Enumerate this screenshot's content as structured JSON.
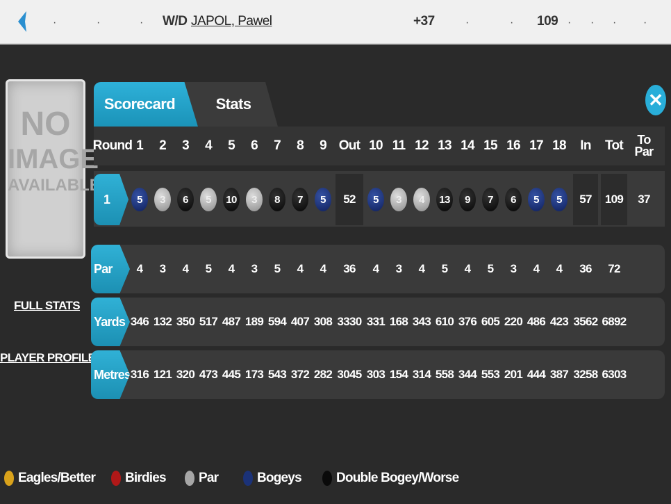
{
  "topbar": {
    "status": "W/D",
    "player_name": "JAPOL, Pawel",
    "to_par": "+37",
    "total": "109",
    "dots": [
      "·",
      "·",
      "·",
      "·",
      "·",
      "·",
      "·",
      "·",
      "·",
      "·"
    ]
  },
  "player_image": {
    "line1": "NO",
    "line2": "IMAGE",
    "line3": "AVAILABLE"
  },
  "links": {
    "full_stats": "FULL STATS",
    "player_profile": "PLAYER PROFILE"
  },
  "tabs": [
    {
      "label": "Scorecard",
      "active": true
    },
    {
      "label": "Stats",
      "active": false
    }
  ],
  "close_icon": "✕",
  "headers": {
    "round": "Round",
    "holes": [
      "1",
      "2",
      "3",
      "4",
      "5",
      "6",
      "7",
      "8",
      "9",
      "Out",
      "10",
      "11",
      "12",
      "13",
      "14",
      "15",
      "16",
      "17",
      "18",
      "In",
      "Tot",
      "To Par"
    ]
  },
  "round1": {
    "round": "1",
    "front": [
      {
        "score": "5",
        "type": "bogey"
      },
      {
        "score": "3",
        "type": "par"
      },
      {
        "score": "6",
        "type": "double"
      },
      {
        "score": "5",
        "type": "par"
      },
      {
        "score": "10",
        "type": "double"
      },
      {
        "score": "3",
        "type": "par"
      },
      {
        "score": "8",
        "type": "double"
      },
      {
        "score": "7",
        "type": "double"
      },
      {
        "score": "5",
        "type": "bogey"
      }
    ],
    "out": "52",
    "back": [
      {
        "score": "5",
        "type": "bogey"
      },
      {
        "score": "3",
        "type": "par"
      },
      {
        "score": "4",
        "type": "par"
      },
      {
        "score": "13",
        "type": "double"
      },
      {
        "score": "9",
        "type": "double"
      },
      {
        "score": "7",
        "type": "double"
      },
      {
        "score": "6",
        "type": "double"
      },
      {
        "score": "5",
        "type": "bogey"
      },
      {
        "score": "5",
        "type": "bogey"
      }
    ],
    "in": "57",
    "tot": "109",
    "to_par": "37"
  },
  "par_row": {
    "label": "Par",
    "values": [
      "4",
      "3",
      "4",
      "5",
      "4",
      "3",
      "5",
      "4",
      "4",
      "36",
      "4",
      "3",
      "4",
      "5",
      "4",
      "5",
      "3",
      "4",
      "4",
      "36",
      "72"
    ]
  },
  "yards_row": {
    "label": "Yards",
    "values": [
      "346",
      "132",
      "350",
      "517",
      "487",
      "189",
      "594",
      "407",
      "308",
      "3330",
      "331",
      "168",
      "343",
      "610",
      "376",
      "605",
      "220",
      "486",
      "423",
      "3562",
      "6892"
    ]
  },
  "metres_row": {
    "label": "Metres",
    "values": [
      "316",
      "121",
      "320",
      "473",
      "445",
      "173",
      "543",
      "372",
      "282",
      "3045",
      "303",
      "154",
      "314",
      "558",
      "344",
      "553",
      "201",
      "444",
      "387",
      "3258",
      "6303"
    ]
  },
  "legend": [
    {
      "label": "Eagles/Better",
      "color": "#d9a21b"
    },
    {
      "label": "Birdies",
      "color": "#b01818"
    },
    {
      "label": "Par",
      "color": "#a6a6a6"
    },
    {
      "label": "Bogeys",
      "color": "#1b3278"
    },
    {
      "label": "Double Bogey/Worse",
      "color": "#0a0a0a"
    }
  ],
  "colors": {
    "accent": "#29aed9",
    "background": "#2a2a2a"
  }
}
